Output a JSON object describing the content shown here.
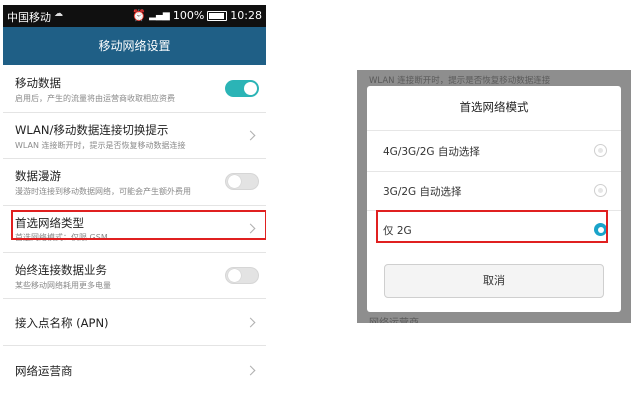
{
  "left": {
    "status_bar": {
      "carrier": "中国移动",
      "battery": "100%",
      "time": "10:28"
    },
    "title": "移动网络设置",
    "items": [
      {
        "title": "移动数据",
        "subtitle": "启用后，产生的流量将由运营商收取相应资费",
        "control": "toggle-on"
      },
      {
        "title": "WLAN/移动数据连接切换提示",
        "subtitle": "WLAN 连接断开时，提示是否恢复移动数据连接",
        "control": "chevron"
      },
      {
        "title": "数据漫游",
        "subtitle": "漫游时连接到移动数据网络，可能会产生额外费用",
        "control": "toggle-off"
      },
      {
        "title": "首选网络类型",
        "subtitle": "首选网络模式：仅限 GSM",
        "control": "chevron"
      },
      {
        "title": "始终连接数据业务",
        "subtitle": "某些移动网络耗用更多电量",
        "control": "toggle-off"
      },
      {
        "title": "接入点名称 (APN)",
        "control": "chevron"
      },
      {
        "title": "网络运营商",
        "control": "chevron"
      }
    ]
  },
  "right": {
    "bg_top_text": "WLAN 连接断开时，提示是否恢复移动数据连接",
    "bg_bottom_text": "网络运营商",
    "dialog": {
      "title": "首选网络模式",
      "options": [
        {
          "label": "4G/3G/2G 自动选择",
          "selected": false
        },
        {
          "label": "3G/2G 自动选择",
          "selected": false
        },
        {
          "label": "仅 2G",
          "selected": true
        }
      ],
      "cancel_label": "取消"
    }
  },
  "colors": {
    "appbar": "#1f5f86",
    "toggle_on": "#2bb4b6",
    "highlight": "#e02020",
    "radio_selected": "#1aa3c9"
  }
}
